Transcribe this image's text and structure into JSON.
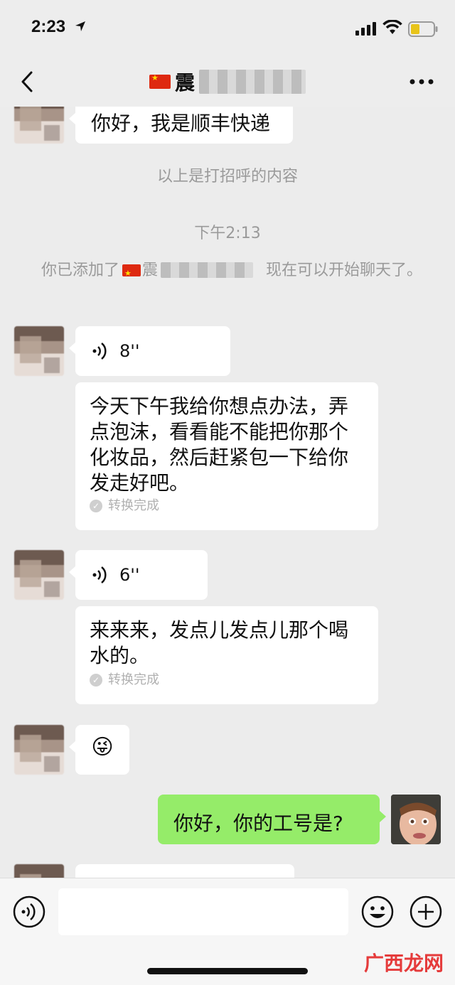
{
  "status_bar": {
    "time": "2:23"
  },
  "nav": {
    "title_prefix": "震"
  },
  "messages": {
    "greeting": "你好，我是顺丰快递",
    "greeting_note": "以上是打招呼的内容",
    "timestamp": "下午2:13",
    "added_prefix": "你已添加了",
    "added_name": "震",
    "added_suffix": "现在可以开始聊天了。",
    "voice1_duration": "8''",
    "voice1_transcript": "今天下午我给你想点办法，弄点泡沫，看看能不能把你那个化妆品，然后赶紧包一下给你发走好吧。",
    "voice1_status": "转换完成",
    "voice2_duration": "6''",
    "voice2_transcript": "来来来，发点儿发点儿那个喝水的。",
    "voice2_status": "转换完成",
    "emoji": "😜",
    "my_message": "你好，你的工号是?"
  },
  "watermark": {
    "logo": "广西龙网"
  },
  "icons": {
    "back": "chevron-left-icon",
    "more": "more-dots-icon",
    "voice_input": "voice-input-icon",
    "emoji": "smiley-icon",
    "plus": "plus-circle-icon"
  }
}
